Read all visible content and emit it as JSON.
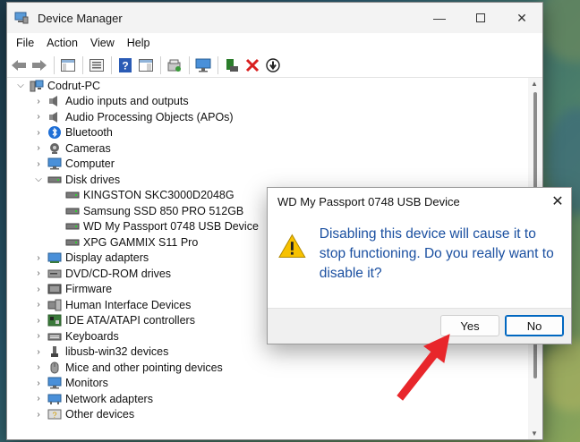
{
  "window": {
    "title": "Device Manager",
    "controls": [
      "minimize",
      "maximize",
      "close"
    ]
  },
  "menu": [
    "File",
    "Action",
    "View",
    "Help"
  ],
  "toolbar_icons": [
    "back-icon",
    "forward-icon",
    "show-hide-console-tree-icon",
    "properties-icon",
    "help-icon",
    "action-pane-icon",
    "scan-hardware-icon",
    "monitor-icon",
    "update-driver-icon",
    "uninstall-icon",
    "disable-device-icon"
  ],
  "tree": {
    "root": "Codrut-PC",
    "items": [
      {
        "label": "Audio inputs and outputs",
        "icon": "speaker-icon",
        "expanded": false
      },
      {
        "label": "Audio Processing Objects (APOs)",
        "icon": "speaker-icon",
        "expanded": false
      },
      {
        "label": "Bluetooth",
        "icon": "bluetooth-icon",
        "expanded": false
      },
      {
        "label": "Cameras",
        "icon": "camera-icon",
        "expanded": false
      },
      {
        "label": "Computer",
        "icon": "computer-icon",
        "expanded": false
      },
      {
        "label": "Disk drives",
        "icon": "disk-drive-icon",
        "expanded": true,
        "children": [
          "KINGSTON SKC3000D2048G",
          "Samsung SSD 850 PRO 512GB",
          "WD My Passport 0748 USB Device",
          "XPG GAMMIX S11 Pro"
        ]
      },
      {
        "label": "Display adapters",
        "icon": "display-adapter-icon",
        "expanded": false
      },
      {
        "label": "DVD/CD-ROM drives",
        "icon": "dvd-icon",
        "expanded": false
      },
      {
        "label": "Firmware",
        "icon": "firmware-icon",
        "expanded": false
      },
      {
        "label": "Human Interface Devices",
        "icon": "hid-icon",
        "expanded": false
      },
      {
        "label": "IDE ATA/ATAPI controllers",
        "icon": "ide-controller-icon",
        "expanded": false
      },
      {
        "label": "Keyboards",
        "icon": "keyboard-icon",
        "expanded": false
      },
      {
        "label": "libusb-win32 devices",
        "icon": "usb-icon",
        "expanded": false
      },
      {
        "label": "Mice and other pointing devices",
        "icon": "mouse-icon",
        "expanded": false
      },
      {
        "label": "Monitors",
        "icon": "monitor-icon",
        "expanded": false
      },
      {
        "label": "Network adapters",
        "icon": "network-adapter-icon",
        "expanded": false
      },
      {
        "label": "Other devices",
        "icon": "other-devices-icon",
        "expanded": false
      }
    ]
  },
  "dialog": {
    "title": "WD My Passport 0748 USB Device",
    "message": "Disabling this device will cause it to stop functioning. Do you really want to disable it?",
    "yes_label": "Yes",
    "no_label": "No",
    "message_color": "#1a4fa0"
  },
  "annotation": {
    "arrow_color": "#e8262b",
    "points_to": "Yes"
  }
}
